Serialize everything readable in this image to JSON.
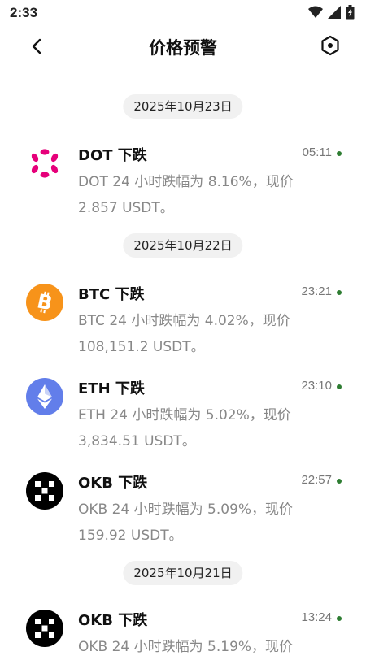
{
  "status_bar": {
    "time": "2:33",
    "icons": [
      "wifi-icon",
      "signal-icon",
      "battery-icon"
    ]
  },
  "header": {
    "title": "价格预警",
    "back_icon": "chevron-left-icon",
    "settings_icon": "hexagon-settings-icon"
  },
  "colors": {
    "unread_dot": "#2e7d32",
    "date_chip_bg": "#f1f1f1",
    "dot_brand": "#e6007a",
    "btc_brand": "#f7931a",
    "eth_brand": "#627eea",
    "okb_brand": "#000000"
  },
  "groups": [
    {
      "date": "2025年10月23日",
      "alerts": [
        {
          "coin": "DOT",
          "icon": "polkadot-logo-icon",
          "title": "DOT 下跌",
          "time": "05:11",
          "desc": "DOT 24 小时跌幅为 8.16%，现价 2.857 USDT。",
          "unread": true
        }
      ]
    },
    {
      "date": "2025年10月22日",
      "alerts": [
        {
          "coin": "BTC",
          "icon": "bitcoin-logo-icon",
          "title": "BTC 下跌",
          "time": "23:21",
          "desc": "BTC 24 小时跌幅为 4.02%，现价 108,151.2 USDT。",
          "unread": true
        },
        {
          "coin": "ETH",
          "icon": "ethereum-logo-icon",
          "title": "ETH 下跌",
          "time": "23:10",
          "desc": "ETH 24 小时跌幅为 5.02%，现价 3,834.51 USDT。",
          "unread": true
        },
        {
          "coin": "OKB",
          "icon": "okb-logo-icon",
          "title": "OKB 下跌",
          "time": "22:57",
          "desc": "OKB 24 小时跌幅为 5.09%，现价 159.92 USDT。",
          "unread": true
        }
      ]
    },
    {
      "date": "2025年10月21日",
      "alerts": [
        {
          "coin": "OKB",
          "icon": "okb-logo-icon",
          "title": "OKB 下跌",
          "time": "13:24",
          "desc": "OKB 24 小时跌幅为 5.19%，现价",
          "unread": true
        }
      ]
    }
  ]
}
